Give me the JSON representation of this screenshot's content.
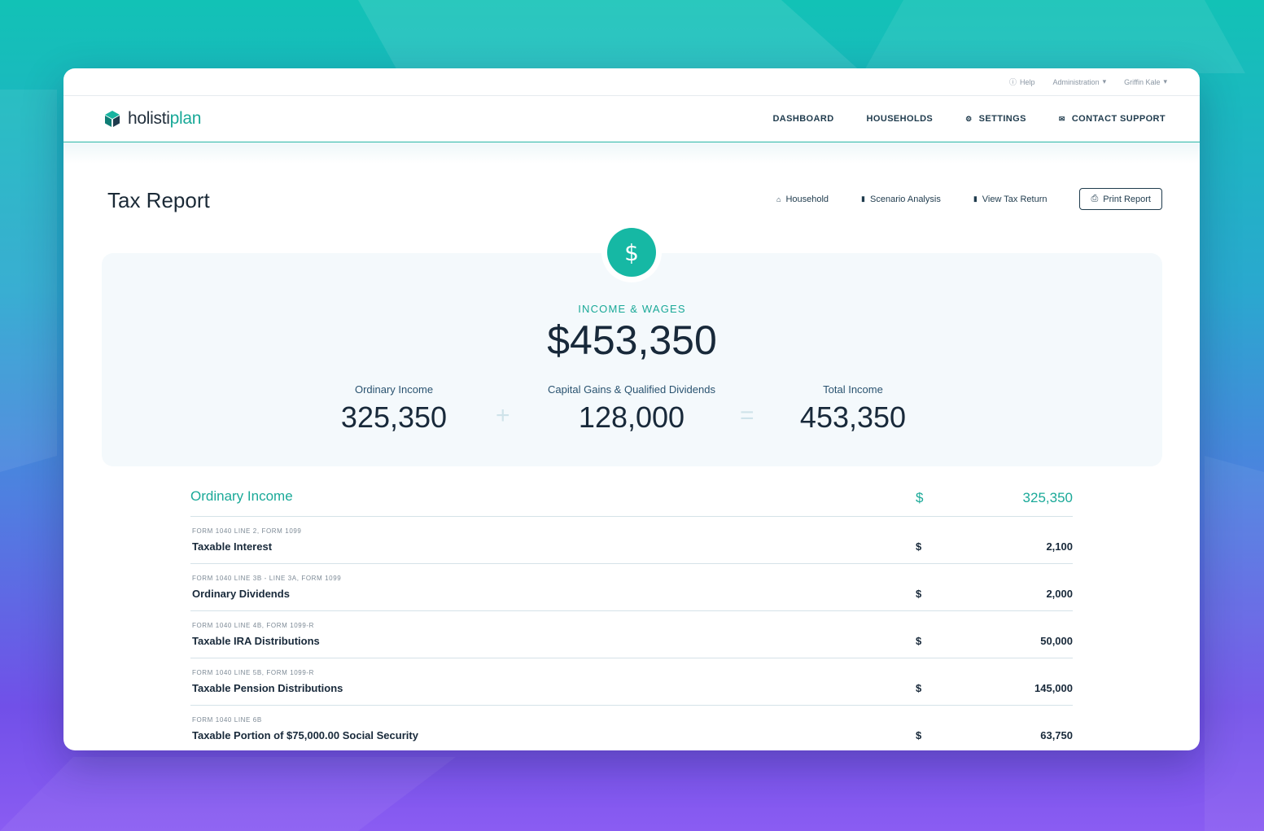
{
  "utility": {
    "help": "Help",
    "admin": "Administration",
    "user": "Griffin Kale"
  },
  "brand": {
    "logo_part1": "holisti",
    "logo_part2": "plan",
    "icon": "cube-logo-icon"
  },
  "nav": {
    "dashboard": "DASHBOARD",
    "households": "HOUSEHOLDS",
    "settings": "SETTINGS",
    "contact": "CONTACT SUPPORT"
  },
  "page": {
    "title": "Tax Report",
    "actions": {
      "household": "Household",
      "scenario": "Scenario Analysis",
      "view_return": "View Tax Return",
      "print": "Print Report"
    }
  },
  "summary": {
    "icon_glyph": "$",
    "label": "INCOME & WAGES",
    "total": "$453,350",
    "ordinary_label": "Ordinary Income",
    "ordinary_value": "325,350",
    "plus": "+",
    "capgains_label": "Capital Gains & Qualified Dividends",
    "capgains_value": "128,000",
    "equals": "=",
    "total_label": "Total Income",
    "total_value": "453,350"
  },
  "ordinary": {
    "title": "Ordinary Income",
    "currency": "$",
    "amount": "325,350",
    "rows": [
      {
        "form": "FORM 1040 LINE 2, FORM 1099",
        "name": "Taxable Interest",
        "currency": "$",
        "amount": "2,100"
      },
      {
        "form": "FORM 1040 LINE 3B - LINE 3A, FORM 1099",
        "name": "Ordinary Dividends",
        "currency": "$",
        "amount": "2,000"
      },
      {
        "form": "FORM 1040 LINE 4B, FORM 1099-R",
        "name": "Taxable IRA Distributions",
        "currency": "$",
        "amount": "50,000"
      },
      {
        "form": "FORM 1040 LINE 5B, FORM 1099-R",
        "name": "Taxable Pension Distributions",
        "currency": "$",
        "amount": "145,000"
      },
      {
        "form": "FORM 1040 LINE 6B",
        "name": "Taxable Portion of $75,000.00 Social Security",
        "currency": "$",
        "amount": "63,750"
      }
    ]
  },
  "colors": {
    "accent": "#1aa998",
    "navy": "#1f3b4d",
    "panel": "#f4f9fc"
  }
}
